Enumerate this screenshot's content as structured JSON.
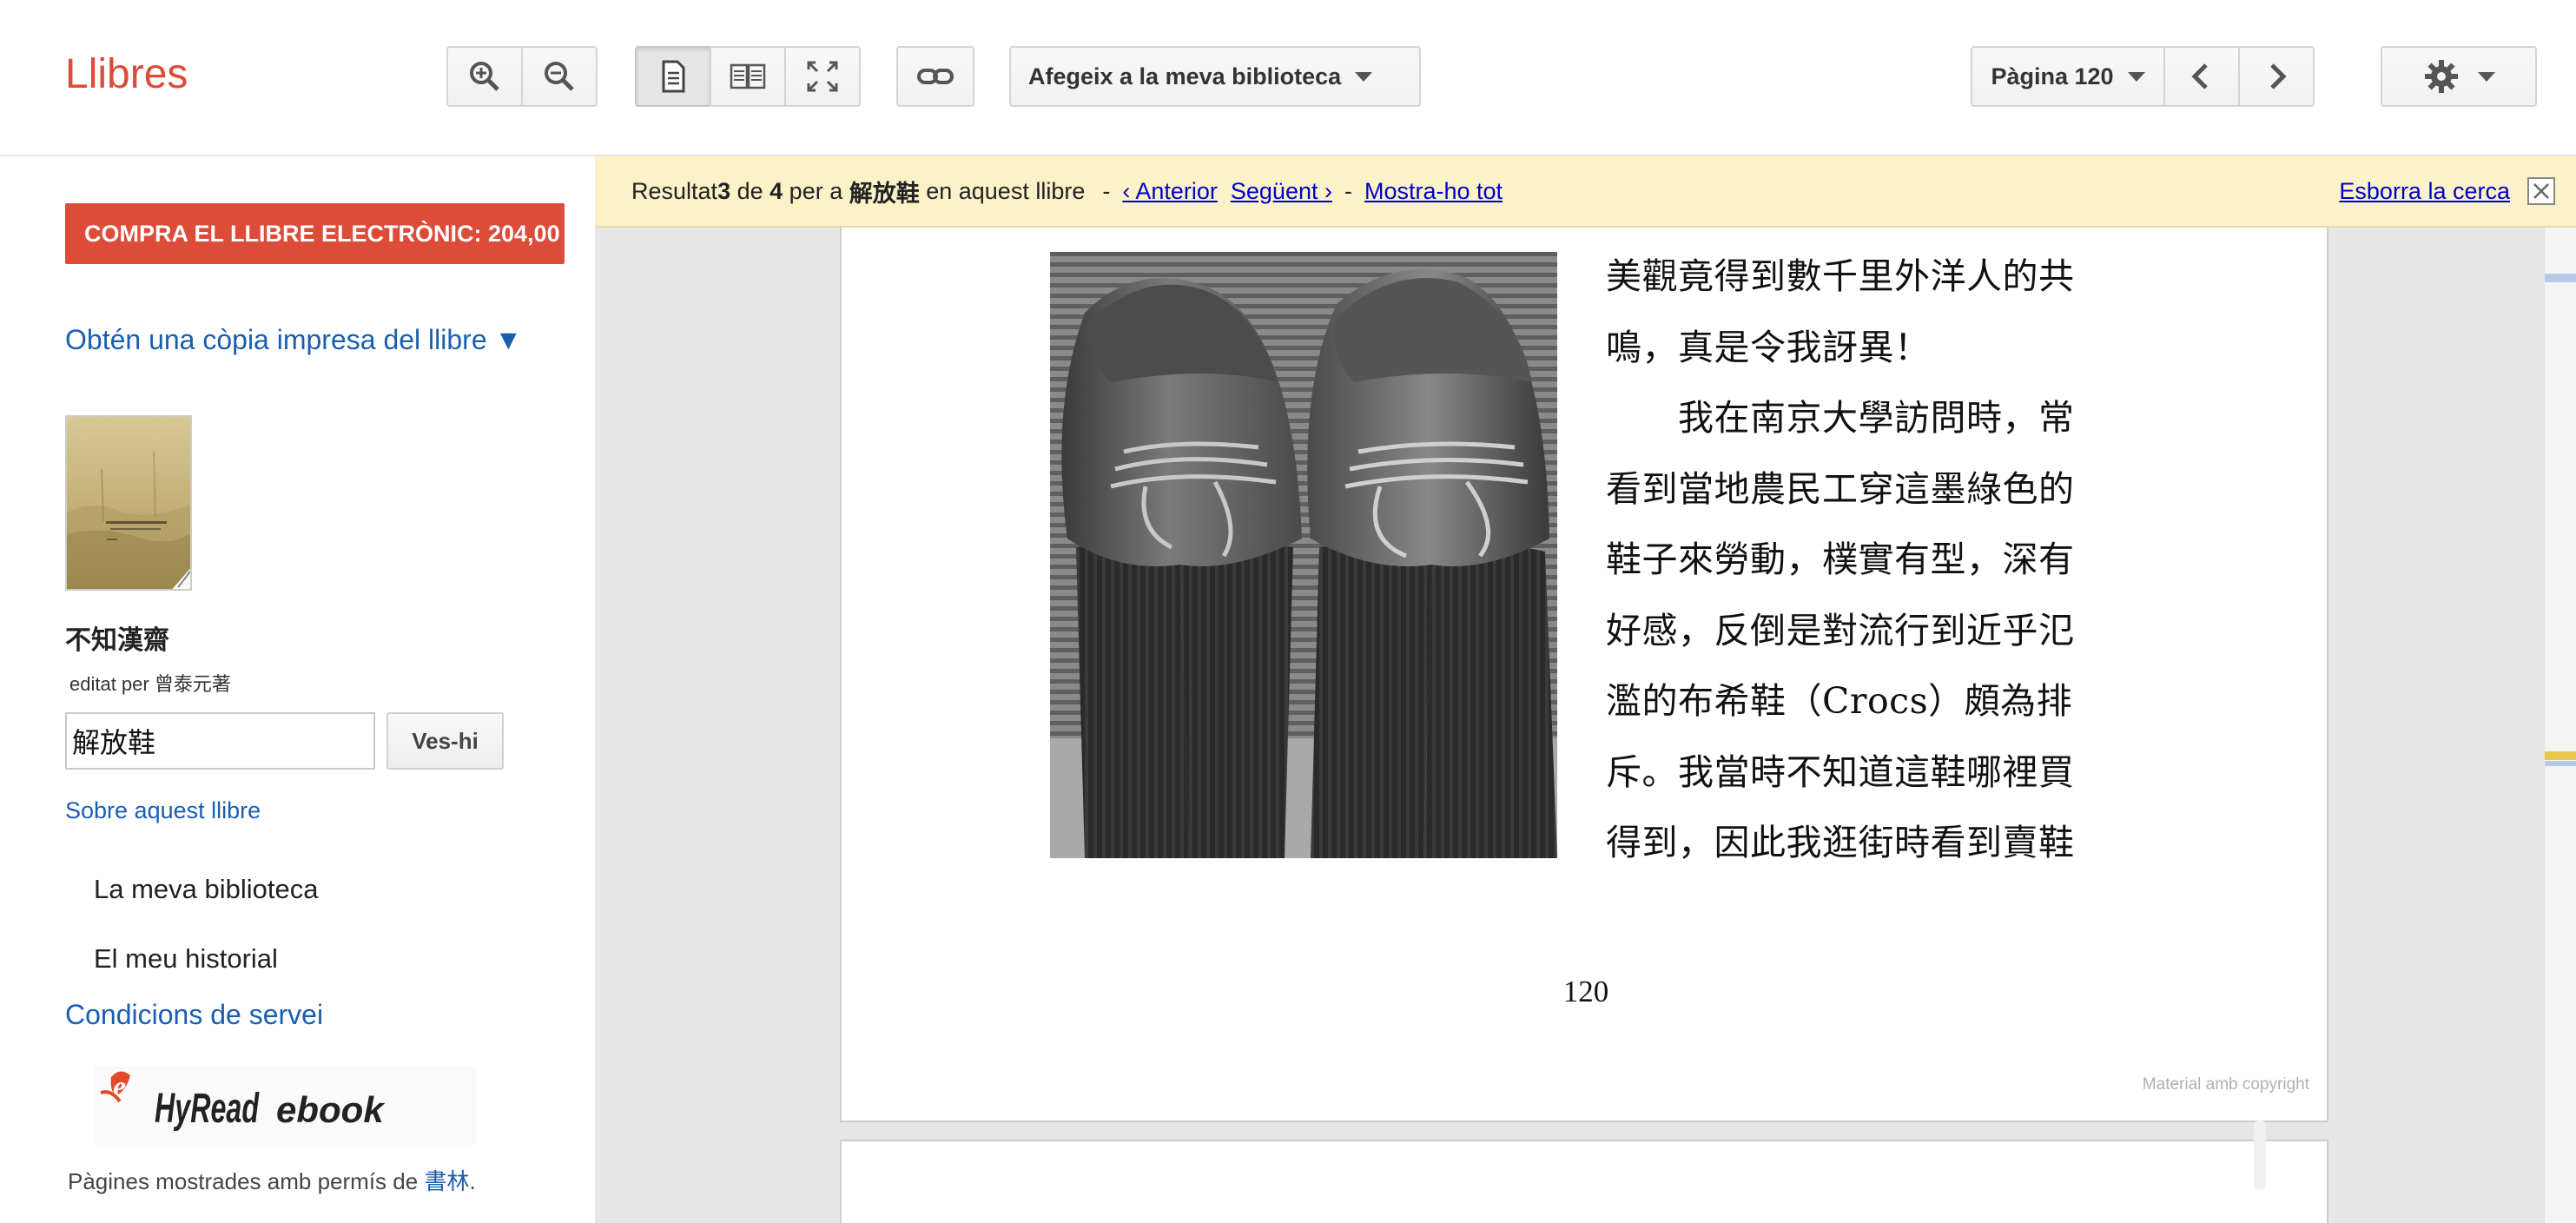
{
  "toolbar": {
    "logo": "Llibres",
    "add_library_label": "Afegeix a la meva biblioteca",
    "page_label": "Pàgina 120"
  },
  "sidebar": {
    "buy_button": "COMPRA EL LLIBRE ELECTRÒNIC: 204,00",
    "print_copy": "Obtén una còpia impresa del llibre ▼",
    "book_title": "不知漢齋",
    "editor": "editat per 曾泰元著",
    "search_value": "解放鞋",
    "go_button": "Ves-hi",
    "about_link": "Sobre aquest llibre",
    "my_library": "La meva biblioteca",
    "my_history": "El meu historial",
    "terms": "Condicions de servei",
    "publisher_logo_text": "HyRead ebook",
    "permission_prefix": "Pàgines mostrades amb permís de ",
    "permission_publisher": "書林",
    "permission_suffix": "."
  },
  "searchbar": {
    "prefix": "Resultat ",
    "current": "3",
    "of": " de ",
    "total": "4",
    "per_a": " per a ",
    "query": "解放鞋",
    "suffix": " en aquest llibre",
    "dash1": "-",
    "prev_link": "‹ Anterior",
    "next_link": "Següent ›",
    "dash2": "-",
    "show_all": "Mostra-ho tot",
    "clear_search": "Esborra la cerca"
  },
  "page": {
    "lines": [
      "美觀竟得到數千里外洋人的共",
      "鳴，真是令我訝異！",
      "　　我在南京大學訪問時，常",
      "看到當地農民工穿這墨綠色的",
      "鞋子來勞動，樸實有型，深有",
      "好感，反倒是對流行到近乎氾",
      "濫的布希鞋（Crocs）頗為排",
      "斥。我當時不知道這鞋哪裡買",
      "得到，因此我逛街時看到賣鞋"
    ],
    "page_number": "120",
    "copyright": "Material amb copyright"
  },
  "colors": {
    "brand_red": "#dd4b39",
    "link_blue": "#1a5eb0",
    "searchbar_bg": "#fcf2c8",
    "viewer_bg": "#e6e6e6"
  }
}
